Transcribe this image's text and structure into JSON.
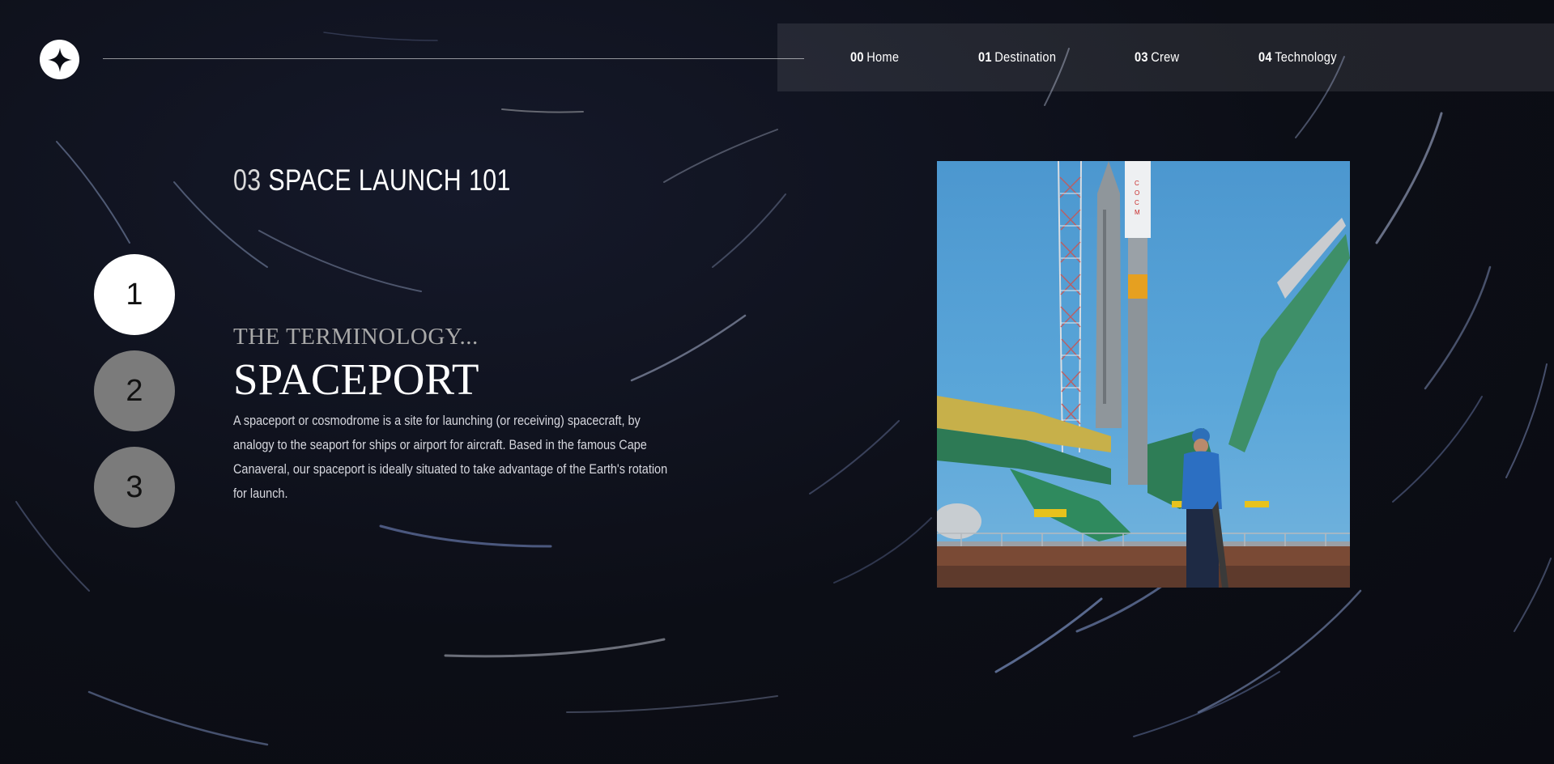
{
  "nav": {
    "items": [
      {
        "num": "00",
        "label": "Home"
      },
      {
        "num": "01",
        "label": "Destination"
      },
      {
        "num": "03",
        "label": "Crew"
      },
      {
        "num": "04",
        "label": "Technology"
      }
    ]
  },
  "page": {
    "heading_num": "03",
    "heading_text": "SPACE LAUNCH 101"
  },
  "steps": [
    "1",
    "2",
    "3"
  ],
  "active_step": 1,
  "content": {
    "eyebrow": "THE TERMINOLOGY...",
    "term": "SPACEPORT",
    "description": "A spaceport or cosmodrome is a site for launching (or receiving) spacecraft, by analogy to the seaport for ships or airport for aircraft. Based in the famous Cape Canaveral, our spaceport is ideally situated to take advantage of the Earth's rotation for launch."
  },
  "colors": {
    "background": "#0b0d15",
    "nav_bar": "rgba(255,255,255,0.09)",
    "active_step": "#ffffff",
    "inactive_step": "#7b7b7b"
  },
  "icons": {
    "logo": "four-point-star-icon"
  },
  "image": {
    "subject": "spaceport-launch-pad-photo"
  }
}
